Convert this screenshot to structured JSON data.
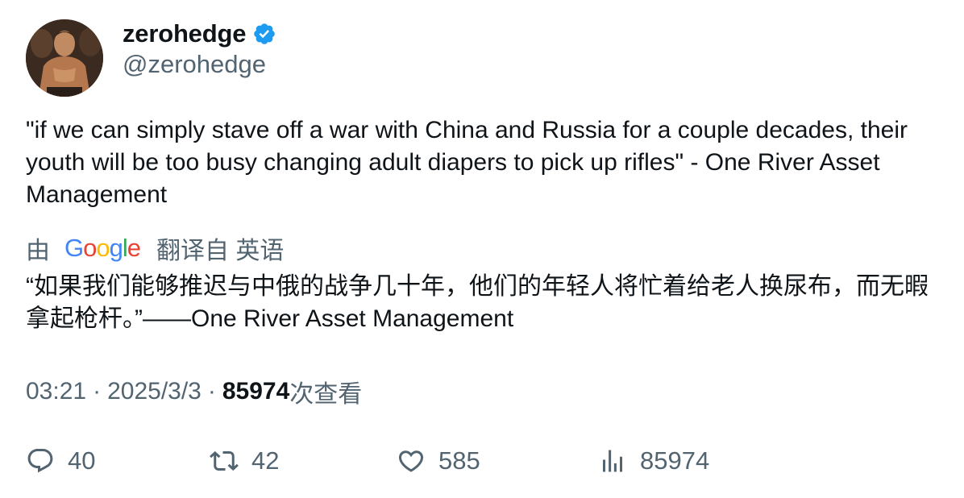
{
  "author": {
    "display_name": "zerohedge",
    "handle": "@zerohedge",
    "verified": true,
    "verified_color": "#1d9bf0",
    "avatar_icon": "avatar-photo"
  },
  "tweet": {
    "text": "\"if we can simply stave off a war with China and Russia for a couple decades, their youth will be too busy changing adult diapers to pick up rifles\" - One River Asset Management"
  },
  "translation": {
    "by_label": "由",
    "provider": "Google",
    "from_label": "翻译自 英语",
    "text": "“如果我们能够推迟与中俄的战争几十年，他们的年轻人将忙着给老人换尿布，而无暇拿起枪杆。”——One River Asset Management"
  },
  "meta": {
    "time": "03:21",
    "separator": "·",
    "date": "2025/3/3",
    "views_count": "85974",
    "views_label": "次查看"
  },
  "actions": {
    "reply": {
      "icon": "reply-icon",
      "count": "40"
    },
    "retweet": {
      "icon": "retweet-icon",
      "count": "42"
    },
    "like": {
      "icon": "heart-icon",
      "count": "585"
    },
    "views": {
      "icon": "views-chart-icon",
      "count": "85974"
    }
  },
  "colors": {
    "text_primary": "#0f1419",
    "text_secondary": "#536471",
    "google_blue": "#4285f4",
    "google_red": "#ea4335",
    "google_yellow": "#fbbc05",
    "google_green": "#34a853"
  }
}
